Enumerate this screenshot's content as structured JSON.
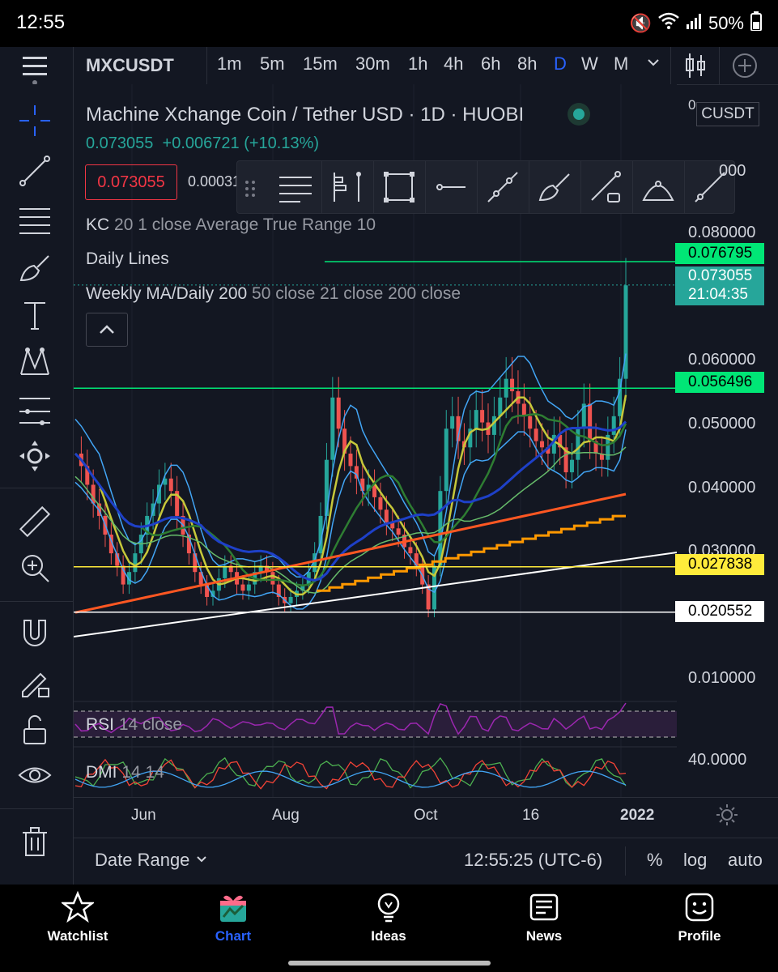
{
  "status_bar": {
    "time": "12:55",
    "battery": "50%"
  },
  "toolbar": {
    "symbol": "MXCUSDT",
    "timeframes": [
      "1m",
      "5m",
      "15m",
      "30m",
      "1h",
      "4h",
      "6h",
      "8h",
      "D",
      "W",
      "M"
    ],
    "active_timeframe": "D"
  },
  "chart_header": {
    "title": "Machine Xchange Coin / Tether USD · 1D · HUOBI",
    "price": "0.073055",
    "change": "+0.006721 (+10.13%)",
    "order_price": "0.073055",
    "spread": "0.00031",
    "axis_currency": "CUSDT"
  },
  "indicators": {
    "kc": {
      "name": "KC",
      "params": "20 1 close Average True Range 10"
    },
    "daily_lines": "Daily Lines",
    "weekly_ma": {
      "name": "Weekly MA/Daily 200",
      "params": "50 close 21 close 200 close"
    },
    "rsi": {
      "name": "RSI",
      "params": "14 close"
    },
    "dmi": {
      "name": "DMI",
      "params": "14 14"
    }
  },
  "price_axis": {
    "labels": [
      "0.080000",
      "0.060000",
      "0.050000",
      "0.040000",
      "0.030000",
      "0.010000"
    ],
    "top_partial": "000",
    "dmi_label": "40.0000"
  },
  "price_tags": {
    "high": "0.076795",
    "last": "0.073055",
    "countdown": "21:04:35",
    "resistance": "0.056496",
    "support1": "0.027838",
    "support2": "0.020552"
  },
  "x_axis": [
    "Jun",
    "Aug",
    "Oct",
    "16",
    "2022"
  ],
  "bottom_bar": {
    "date_range": "Date Range",
    "clock": "12:55:25 (UTC-6)",
    "pct": "%",
    "log": "log",
    "auto": "auto"
  },
  "nav": [
    {
      "label": "Watchlist"
    },
    {
      "label": "Chart"
    },
    {
      "label": "Ideas"
    },
    {
      "label": "News"
    },
    {
      "label": "Profile"
    }
  ],
  "colors": {
    "accent": "#2962ff",
    "bg": "#131722",
    "green_line": "#00e676",
    "yellow_line": "#ffeb3b",
    "chart_nav": "#2962ff"
  },
  "chart_data": {
    "type": "line",
    "price_ylim": [
      0.01,
      0.082
    ],
    "x_ticks": [
      "Jun",
      "Aug",
      "Oct",
      "16",
      "2022"
    ],
    "close": [
      0.046,
      0.044,
      0.041,
      0.038,
      0.036,
      0.033,
      0.03,
      0.028,
      0.025,
      0.027,
      0.03,
      0.033,
      0.036,
      0.038,
      0.041,
      0.042,
      0.04,
      0.036,
      0.033,
      0.03,
      0.027,
      0.025,
      0.023,
      0.024,
      0.026,
      0.028,
      0.027,
      0.025,
      0.024,
      0.025,
      0.027,
      0.028,
      0.027,
      0.025,
      0.023,
      0.022,
      0.023,
      0.024,
      0.025,
      0.027,
      0.03,
      0.036,
      0.045,
      0.055,
      0.05,
      0.046,
      0.044,
      0.042,
      0.04,
      0.041,
      0.039,
      0.037,
      0.035,
      0.034,
      0.033,
      0.031,
      0.03,
      0.028,
      0.025,
      0.021,
      0.028,
      0.04,
      0.05,
      0.052,
      0.048,
      0.047,
      0.05,
      0.053,
      0.051,
      0.049,
      0.052,
      0.055,
      0.058,
      0.056,
      0.054,
      0.052,
      0.05,
      0.048,
      0.047,
      0.046,
      0.049,
      0.047,
      0.043,
      0.045,
      0.05,
      0.054,
      0.048,
      0.046,
      0.045,
      0.049,
      0.052,
      0.058,
      0.073
    ]
  }
}
